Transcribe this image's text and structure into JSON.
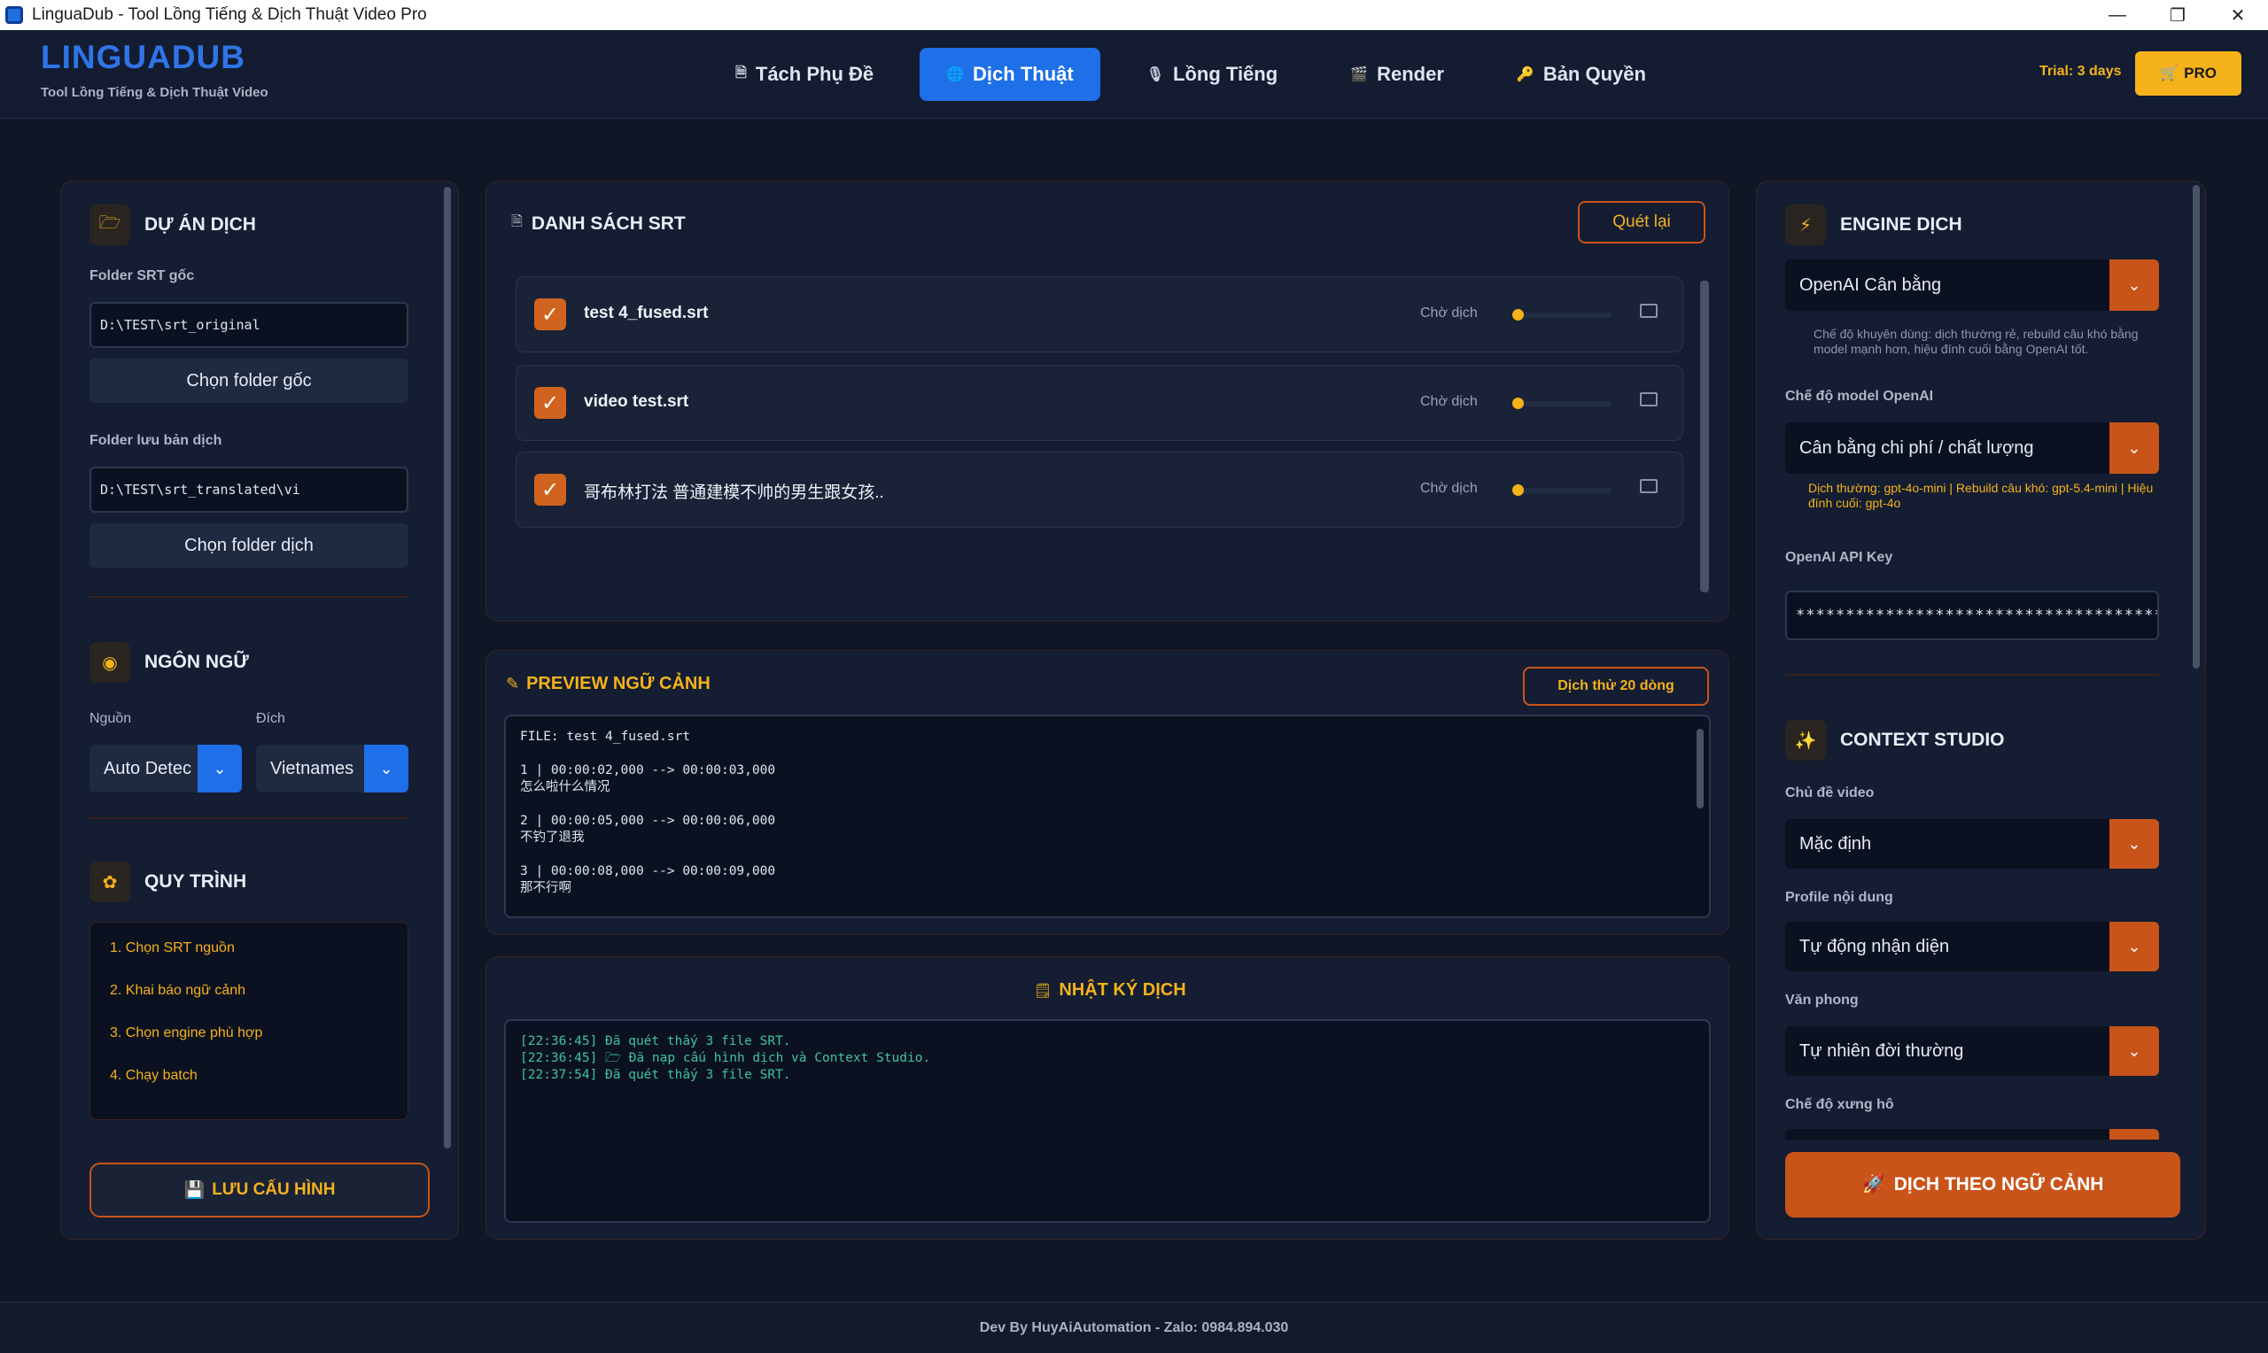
{
  "window": {
    "title": "LinguaDub - Tool Lồng Tiếng & Dịch Thuật Video Pro",
    "minimize": "—",
    "maximize": "❐",
    "close": "✕"
  },
  "brand": {
    "logo": "LINGUADUB",
    "tagline": "Tool Lồng Tiếng & Dịch Thuật Video"
  },
  "nav": {
    "tabs": [
      {
        "icon": "🗎",
        "label": "Tách Phụ Đề"
      },
      {
        "icon": "🌐",
        "label": "Dịch Thuật"
      },
      {
        "icon": "🎙",
        "label": "Lồng Tiếng"
      },
      {
        "icon": "🎬",
        "label": "Render"
      },
      {
        "icon": "🔑",
        "label": "Bản Quyền"
      }
    ],
    "active_tab": "Dịch Thuật",
    "trial": "Trial: 3 days",
    "pro_icon": "🛒",
    "pro_label": "PRO"
  },
  "left": {
    "project": {
      "icon": "🗁",
      "title": "DỰ ÁN DỊCH",
      "src_label": "Folder SRT gốc",
      "src_value": "D:\\TEST\\srt_original",
      "src_button": "Chọn folder gốc",
      "dst_label": "Folder lưu bản dịch",
      "dst_value": "D:\\TEST\\srt_translated\\vi",
      "dst_button": "Chọn folder dịch"
    },
    "language": {
      "icon": "◉",
      "title": "NGÔN NGỮ",
      "src_label": "Nguồn",
      "dst_label": "Đích",
      "src_value": "Auto Detec",
      "dst_value": "Vietnames"
    },
    "workflow": {
      "icon": "✿",
      "title": "QUY TRÌNH",
      "steps": [
        "1. Chọn SRT nguồn",
        "2. Khai báo ngữ cảnh",
        "3. Chọn engine phù hợp",
        "4. Chạy batch"
      ]
    },
    "save_icon": "💾",
    "save_button": "LƯU CẤU HÌNH"
  },
  "srt": {
    "icon": "🗎",
    "title": "DANH SÁCH SRT",
    "rescan": "Quét lại",
    "files": [
      {
        "name": "test 4_fused.srt",
        "status": "Chờ dịch",
        "progress": 0
      },
      {
        "name": "video test.srt",
        "status": "Chờ dịch",
        "progress": 0
      },
      {
        "name": "哥布林打法 普通建模不帅的男生跟女孩..",
        "status": "Chờ dịch",
        "progress": 0
      }
    ]
  },
  "preview": {
    "icon": "✎",
    "title": "PREVIEW NGỮ CẢNH",
    "button": "Dịch thử 20 dòng",
    "lines": [
      "FILE: test 4_fused.srt",
      "",
      "1 | 00:00:02,000 --> 00:00:03,000",
      "怎么啦什么情况",
      "",
      "2 | 00:00:05,000 --> 00:00:06,000",
      "不钓了退我",
      "",
      "3 | 00:00:08,000 --> 00:00:09,000",
      "那不行啊"
    ]
  },
  "log": {
    "icon": "🗒",
    "title": "NHẬT KÝ DỊCH",
    "lines": [
      "[22:36:45] Đã quét thấy 3 file SRT.",
      "[22:36:45] 🗁 Đã nạp cấu hình dịch và Context Studio.",
      "[22:37:54] Đã quét thấy 3 file SRT."
    ]
  },
  "right": {
    "engine": {
      "icon": "⚡",
      "title": "ENGINE DỊCH",
      "engine_value": "OpenAI Cân bằng",
      "engine_note": "Chế độ khuyên dùng: dịch thường rẻ, rebuild câu khó bằng model mạnh hơn, hiệu đính cuối bằng OpenAI tốt.",
      "model_label": "Chế độ model OpenAI",
      "model_value": "Cân bằng chi phí / chất lượng",
      "model_note": "Dịch thường: gpt-4o-mini | Rebuild câu khó: gpt-5.4-mini | Hiệu đính cuối: gpt-4o",
      "api_label": "OpenAI API Key",
      "api_value": "********************************************"
    },
    "context": {
      "icon": "✨",
      "title": "CONTEXT STUDIO",
      "topic_label": "Chủ đề video",
      "topic_value": "Mặc định",
      "profile_label": "Profile nội dung",
      "profile_value": "Tự động nhận diện",
      "style_label": "Văn phong",
      "style_value": "Tự nhiên đời thường",
      "pronoun_label": "Chế độ xưng hô"
    },
    "run_icon": "🚀",
    "run_button": "DỊCH THEO NGỮ CẢNH"
  },
  "footer": "Dev By HuyAiAutomation - Zalo: 0984.894.030",
  "colors": {
    "accent_blue": "#1e6fe8",
    "accent_orange": "#c9541a",
    "accent_yellow": "#f5b21b",
    "bg": "#0f1626"
  }
}
